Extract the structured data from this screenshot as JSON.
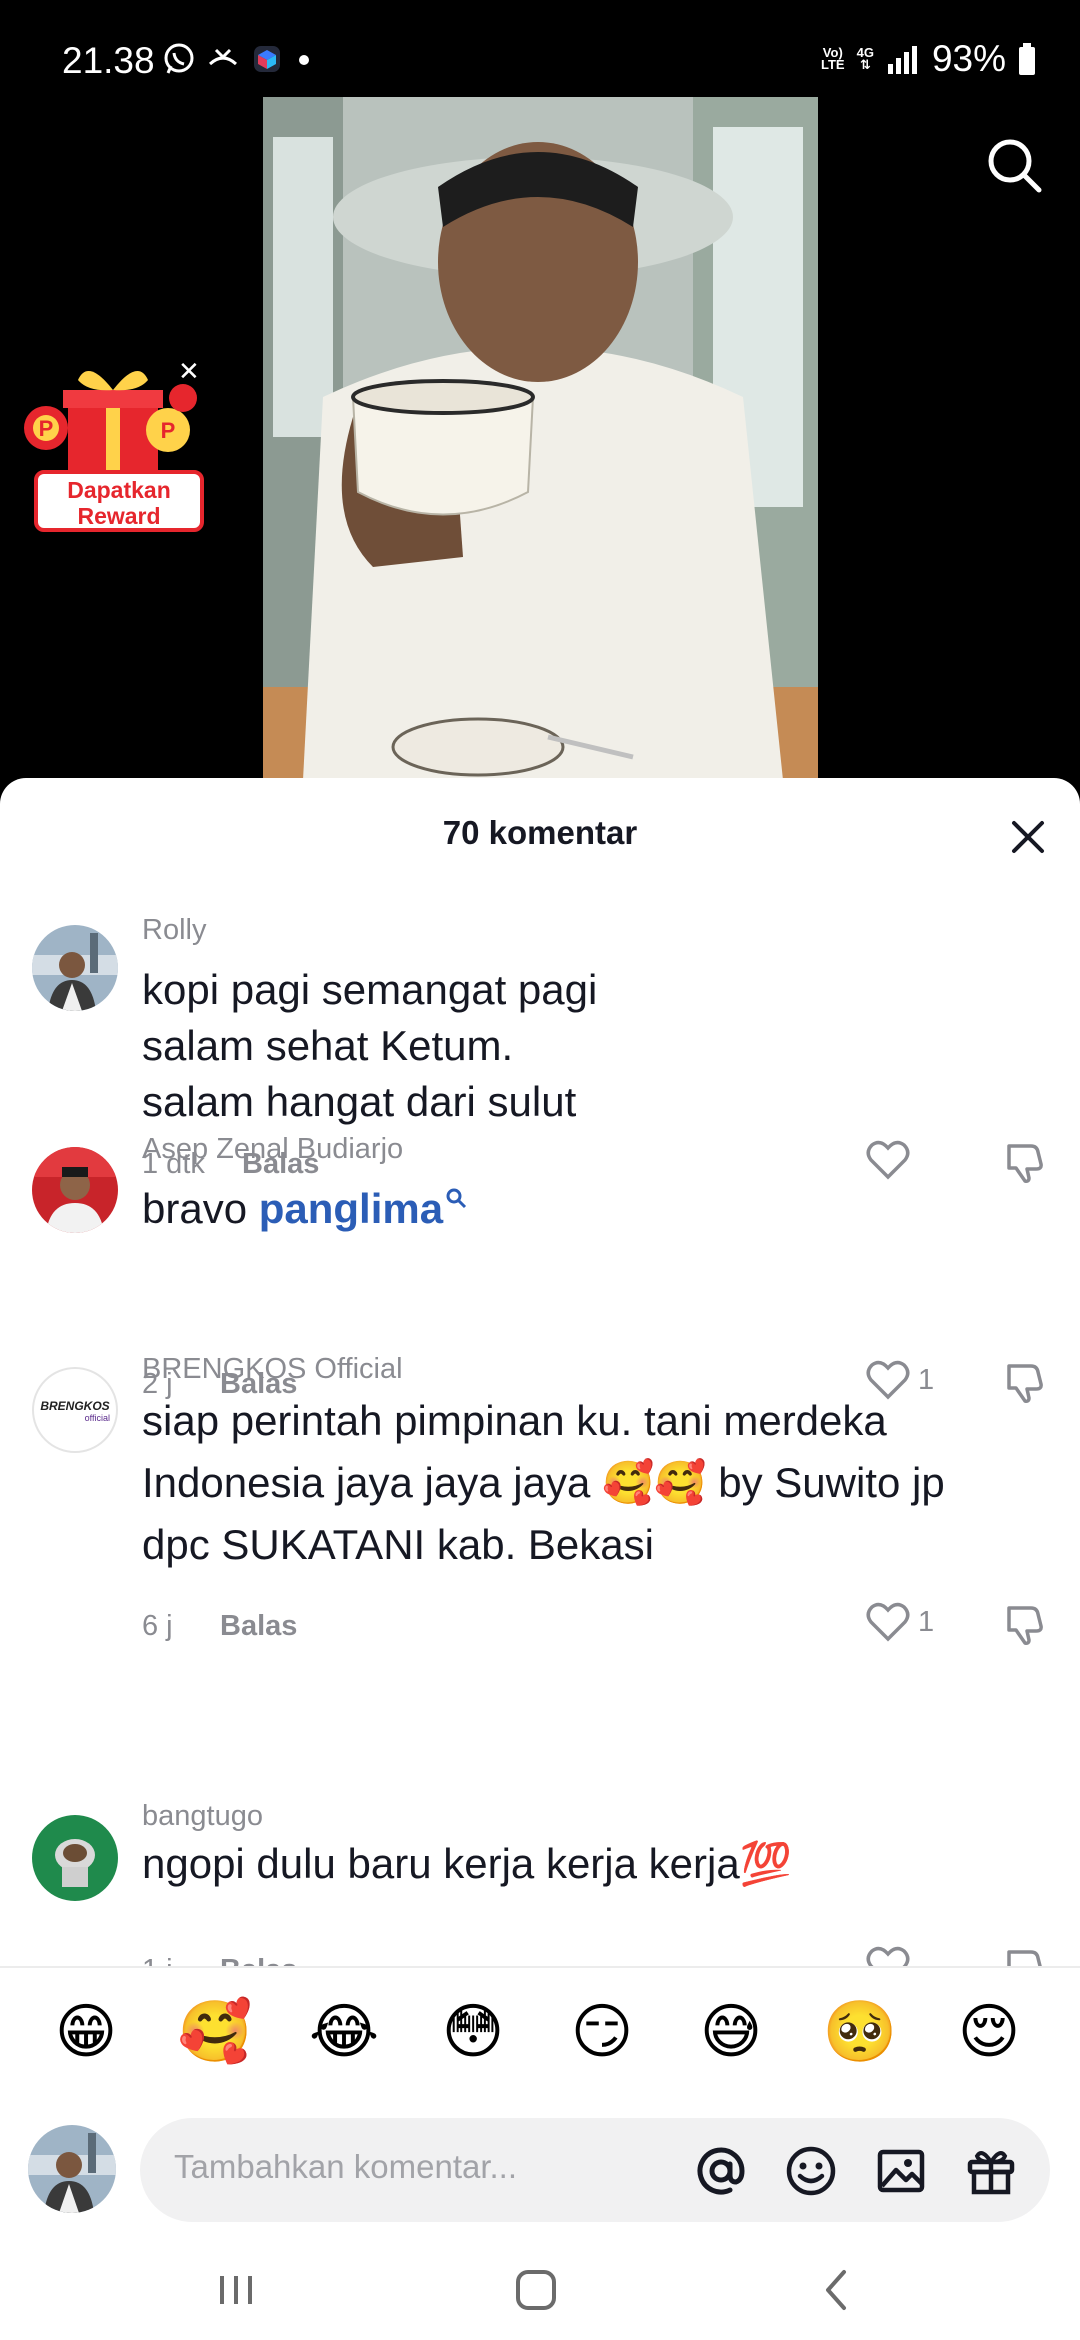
{
  "status_bar": {
    "time": "21.38",
    "battery": "93%",
    "network_top": "Vo)",
    "network_bottom": "LTE",
    "gen": "4G"
  },
  "reward": {
    "label_line1": "Dapatkan",
    "label_line2": "Reward"
  },
  "sheet": {
    "title": "70 komentar"
  },
  "comments": [
    {
      "user": "Rolly",
      "lines": [
        "kopi pagi semangat pagi",
        "salam sehat Ketum.",
        "salam hangat dari sulut"
      ],
      "time": "1 dtk",
      "reply": "Balas",
      "likes": ""
    },
    {
      "user": "Asep Zenal Budiarjo",
      "text_prefix": "bravo ",
      "link": "panglima",
      "time": "2 j",
      "reply": "Balas",
      "likes": "1"
    },
    {
      "user": "BRENGKOS Official",
      "avatar_text": "BRENGKOS",
      "avatar_sub": "official",
      "lines": [
        "siap perintah pimpinan ku. tani merdeka",
        "Indonesia jaya jaya jaya 🥰🥰 by Suwito jp",
        "dpc SUKATANI kab. Bekasi"
      ],
      "time": "6 j",
      "reply": "Balas",
      "likes": "1"
    },
    {
      "user": "bangtugo",
      "lines": [
        "ngopi dulu baru kerja kerja kerja💯"
      ],
      "time": "1 j",
      "reply": "Balas",
      "likes": ""
    }
  ],
  "emoji_bar": [
    "😁",
    "🥰",
    "😂",
    "😳",
    "😏",
    "😅",
    "🥺",
    "😌"
  ],
  "input": {
    "placeholder": "Tambahkan komentar..."
  },
  "colors": {
    "link": "#2b5db6",
    "muted": "#8a8b91",
    "text": "#161823",
    "reward_red": "#e6262d"
  }
}
